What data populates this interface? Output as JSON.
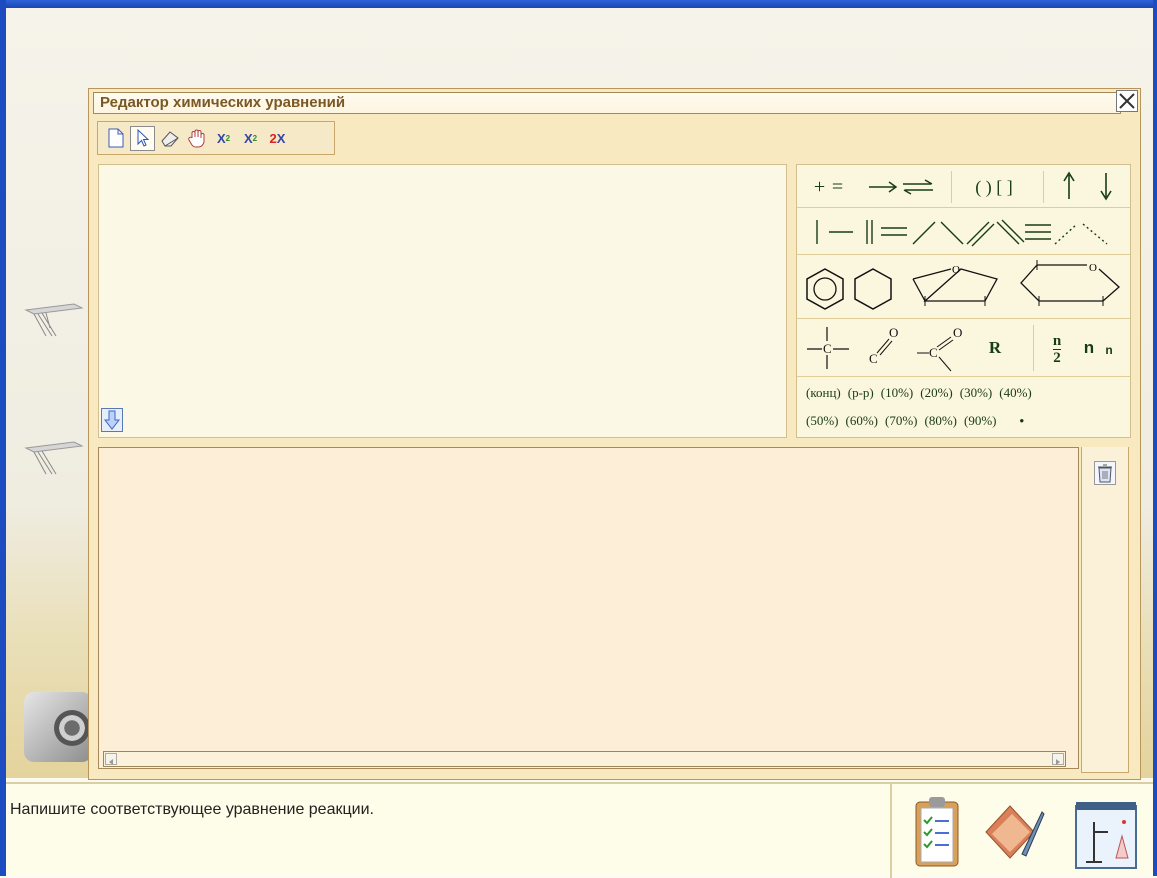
{
  "dialog": {
    "title": "Редактор химических уравнений",
    "close_icon": "close-x-icon"
  },
  "toolbar": {
    "buttons": [
      {
        "icon": "new-document-icon"
      },
      {
        "icon": "pointer-arrow-icon",
        "selected": true
      },
      {
        "icon": "eraser-icon"
      },
      {
        "icon": "hand-pan-icon"
      },
      {
        "icon": "superscript-icon",
        "label": "X²"
      },
      {
        "icon": "subscript-icon",
        "label": "X₂"
      },
      {
        "icon": "coefficient-icon",
        "label": "2X"
      }
    ]
  },
  "palette": {
    "operators": [
      "+",
      "="
    ],
    "brackets": "( ) [ ]",
    "symbols_r": "R",
    "fraction": {
      "num": "n",
      "den": "2"
    },
    "n_large": "n",
    "n_small": "n",
    "carbonyl_o": "O",
    "carbonyl_c": "C",
    "carbon": "C",
    "furan_o": "O",
    "pyran_o": "O",
    "labels_row1": [
      "(конц)",
      "(р-р)",
      "(10%)",
      "(20%)",
      "(30%)",
      "(40%)"
    ],
    "labels_row2": [
      "(50%)",
      "(60%)",
      "(70%)",
      "(80%)",
      "(90%)",
      "•"
    ]
  },
  "status": {
    "text": "Напишите соответствующее уравнение реакции."
  },
  "bottom_icons": [
    "clipboard-checklist-icon",
    "folder-pen-icon",
    "lab-stand-icon"
  ],
  "colors": {
    "title_text": "#7a5823",
    "dialog_bg": "#f9e9c0",
    "editor_bg": "#fbf8e5",
    "output_bg": "#fdeed8"
  }
}
